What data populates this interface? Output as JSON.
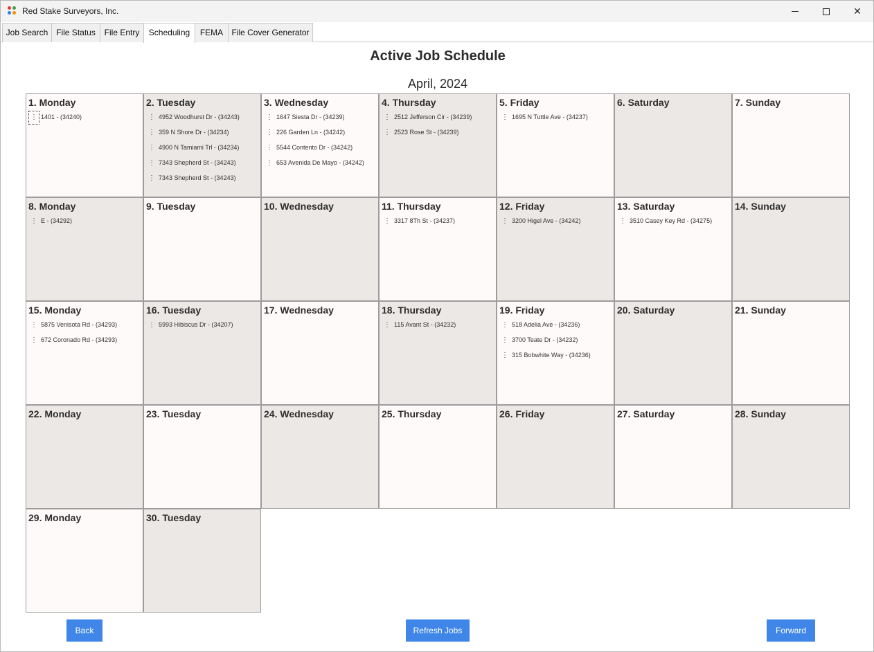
{
  "window": {
    "title": "Red Stake Surveyors, Inc.",
    "icon": "app-dots-icon",
    "icon_colors": [
      "#e53935",
      "#43a047",
      "#1e88e5",
      "#fb8c00"
    ],
    "controls": [
      "minimize-icon",
      "maximize-icon",
      "close-icon"
    ]
  },
  "tabs": [
    {
      "label": "Job Search",
      "active": false
    },
    {
      "label": "File Status",
      "active": false
    },
    {
      "label": "File Entry",
      "active": false
    },
    {
      "label": "Scheduling",
      "active": true
    },
    {
      "label": "FEMA",
      "active": false
    },
    {
      "label": "File Cover Generator",
      "active": false
    }
  ],
  "schedule": {
    "title": "Active Job Schedule",
    "month": "April, 2024",
    "handle_glyph": "⋮",
    "days": [
      {
        "label": "1. Monday",
        "jobs": [
          "1401 - (34240)"
        ]
      },
      {
        "label": "2. Tuesday",
        "jobs": [
          "4952 Woodhurst Dr - (34243)",
          "359 N Shore Dr - (34234)",
          "4900 N Tamiami Trl - (34234)",
          "7343 Shepherd St - (34243)",
          "7343 Shepherd St - (34243)"
        ]
      },
      {
        "label": "3. Wednesday",
        "jobs": [
          "1647 Siesta Dr - (34239)",
          "226 Garden Ln - (34242)",
          "5544 Contento Dr - (34242)",
          "653 Avenida De Mayo - (34242)"
        ]
      },
      {
        "label": "4. Thursday",
        "jobs": [
          "2512 Jefferson Cir - (34239)",
          "2523 Rose St - (34239)"
        ]
      },
      {
        "label": "5. Friday",
        "jobs": [
          "1695 N Tuttle Ave - (34237)"
        ]
      },
      {
        "label": "6. Saturday",
        "jobs": []
      },
      {
        "label": "7. Sunday",
        "jobs": []
      },
      {
        "label": "8. Monday",
        "jobs": [
          "E - (34292)"
        ]
      },
      {
        "label": "9. Tuesday",
        "jobs": []
      },
      {
        "label": "10. Wednesday",
        "jobs": []
      },
      {
        "label": "11. Thursday",
        "jobs": [
          "3317 8Th St - (34237)"
        ]
      },
      {
        "label": "12. Friday",
        "jobs": [
          "3200 Higel Ave - (34242)"
        ]
      },
      {
        "label": "13. Saturday",
        "jobs": [
          "3510 Casey Key Rd - (34275)"
        ]
      },
      {
        "label": "14. Sunday",
        "jobs": []
      },
      {
        "label": "15. Monday",
        "jobs": [
          "5875 Venisota Rd - (34293)",
          "672 Coronado Rd - (34293)"
        ]
      },
      {
        "label": "16. Tuesday",
        "jobs": [
          "5993 Hibiscus Dr - (34207)"
        ]
      },
      {
        "label": "17. Wednesday",
        "jobs": []
      },
      {
        "label": "18. Thursday",
        "jobs": [
          "115 Avant St - (34232)"
        ]
      },
      {
        "label": "19. Friday",
        "jobs": [
          "518 Adelia Ave - (34236)",
          "3700 Teate Dr - (34232)",
          "315 Bobwhite Way - (34236)"
        ]
      },
      {
        "label": "20. Saturday",
        "jobs": []
      },
      {
        "label": "21. Sunday",
        "jobs": []
      },
      {
        "label": "22. Monday",
        "jobs": []
      },
      {
        "label": "23. Tuesday",
        "jobs": []
      },
      {
        "label": "24. Wednesday",
        "jobs": []
      },
      {
        "label": "25. Thursday",
        "jobs": []
      },
      {
        "label": "26. Friday",
        "jobs": []
      },
      {
        "label": "27. Saturday",
        "jobs": []
      },
      {
        "label": "28. Sunday",
        "jobs": []
      },
      {
        "label": "29. Monday",
        "jobs": []
      },
      {
        "label": "30. Tuesday",
        "jobs": []
      }
    ]
  },
  "buttons": {
    "back": "Back",
    "refresh": "Refresh Jobs",
    "forward": "Forward"
  },
  "colors": {
    "accent": "#3f86e8",
    "cell_light": "#fefaf9",
    "cell_dark": "#ebe8e6"
  }
}
